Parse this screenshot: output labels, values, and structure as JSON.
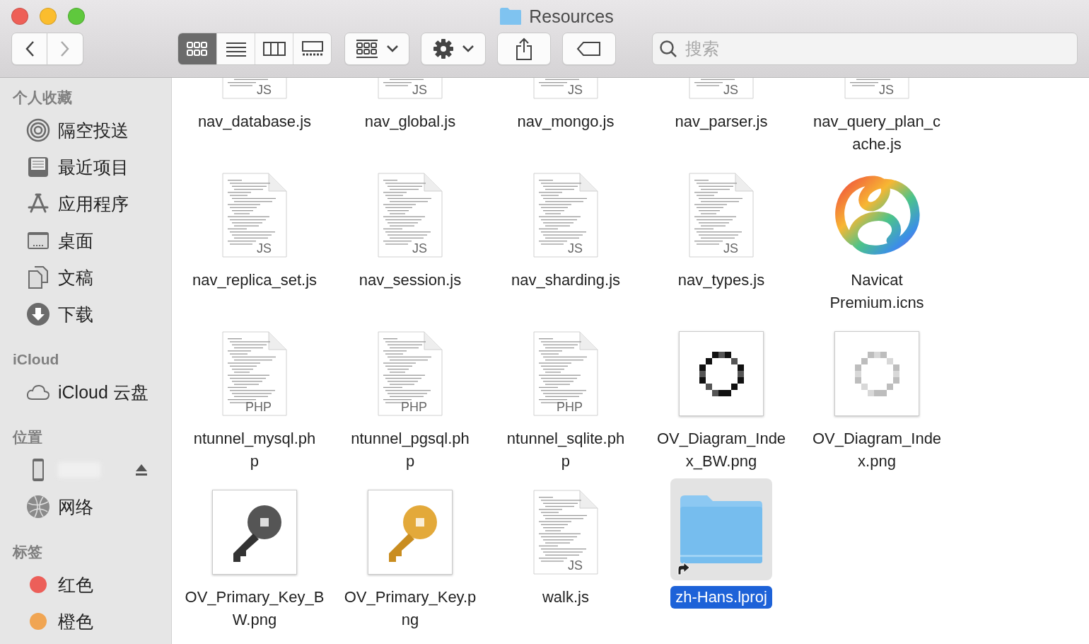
{
  "window": {
    "title": "Resources"
  },
  "toolbar": {
    "back": {
      "disabled": false
    },
    "forward": {
      "disabled": true
    },
    "views": [
      {
        "kind": "icons",
        "selected": true
      },
      {
        "kind": "list",
        "selected": false
      },
      {
        "kind": "columns",
        "selected": false
      },
      {
        "kind": "gallery",
        "selected": false
      }
    ],
    "search": {
      "placeholder": "搜索"
    }
  },
  "sidebar": {
    "sections": [
      {
        "title": "个人收藏",
        "items": [
          {
            "kind": "airdrop",
            "label": "隔空投送"
          },
          {
            "kind": "recents",
            "label": "最近项目"
          },
          {
            "kind": "apps",
            "label": "应用程序"
          },
          {
            "kind": "desktop",
            "label": "桌面"
          },
          {
            "kind": "documents",
            "label": "文稿"
          },
          {
            "kind": "downloads",
            "label": "下载"
          }
        ]
      },
      {
        "title": "iCloud",
        "items": [
          {
            "kind": "cloud",
            "label": "iCloud 云盘"
          }
        ]
      },
      {
        "title": "位置",
        "items": [
          {
            "kind": "device",
            "ejectable": true
          },
          {
            "kind": "network",
            "label": "网络"
          }
        ]
      },
      {
        "title": "标签",
        "items": [
          {
            "kind": "tag",
            "label": "红色",
            "color": "#ec5f59"
          },
          {
            "kind": "tag",
            "label": "橙色",
            "color": "#f0a553"
          }
        ]
      }
    ]
  },
  "files": [
    {
      "kind": "js-file",
      "badge": "JS",
      "lines": [
        "nav_database.js"
      ],
      "selected": false
    },
    {
      "kind": "js-file",
      "badge": "JS",
      "lines": [
        "nav_global.js"
      ],
      "selected": false
    },
    {
      "kind": "js-file",
      "badge": "JS",
      "lines": [
        "nav_mongo.js"
      ],
      "selected": false
    },
    {
      "kind": "js-file",
      "badge": "JS",
      "lines": [
        "nav_parser.js"
      ],
      "selected": false
    },
    {
      "kind": "js-file",
      "badge": "JS",
      "lines": [
        "nav_query_plan_c",
        "ache.js"
      ],
      "selected": false
    },
    {
      "kind": "js-file",
      "badge": "JS",
      "lines": [
        "nav_replica_set.js"
      ],
      "selected": false
    },
    {
      "kind": "js-file",
      "badge": "JS",
      "lines": [
        "nav_session.js"
      ],
      "selected": false
    },
    {
      "kind": "js-file",
      "badge": "JS",
      "lines": [
        "nav_sharding.js"
      ],
      "selected": false
    },
    {
      "kind": "js-file",
      "badge": "JS",
      "lines": [
        "nav_types.js"
      ],
      "selected": false
    },
    {
      "kind": "app-icon",
      "lines": [
        "Navicat",
        "Premium.icns"
      ],
      "selected": false
    },
    {
      "kind": "php-file",
      "badge": "PHP",
      "lines": [
        "ntunnel_mysql.ph",
        "p"
      ],
      "selected": false
    },
    {
      "kind": "php-file",
      "badge": "PHP",
      "lines": [
        "ntunnel_pgsql.ph",
        "p"
      ],
      "selected": false
    },
    {
      "kind": "php-file",
      "badge": "PHP",
      "lines": [
        "ntunnel_sqlite.ph",
        "p"
      ],
      "selected": false
    },
    {
      "kind": "ring-dark",
      "lines": [
        "OV_Diagram_Inde",
        "x_BW.png"
      ],
      "selected": false
    },
    {
      "kind": "ring-grey",
      "lines": [
        "OV_Diagram_Inde",
        "x.png"
      ],
      "selected": false
    },
    {
      "kind": "key-dark",
      "lines": [
        "OV_Primary_Key_B",
        "W.png"
      ],
      "selected": false
    },
    {
      "kind": "key-gold",
      "lines": [
        "OV_Primary_Key.p",
        "ng"
      ],
      "selected": false
    },
    {
      "kind": "js-file",
      "badge": "JS",
      "lines": [
        "walk.js"
      ],
      "selected": false
    },
    {
      "kind": "folder",
      "lines": [
        "zh-Hans.lproj"
      ],
      "selected": true,
      "alias": true
    }
  ]
}
